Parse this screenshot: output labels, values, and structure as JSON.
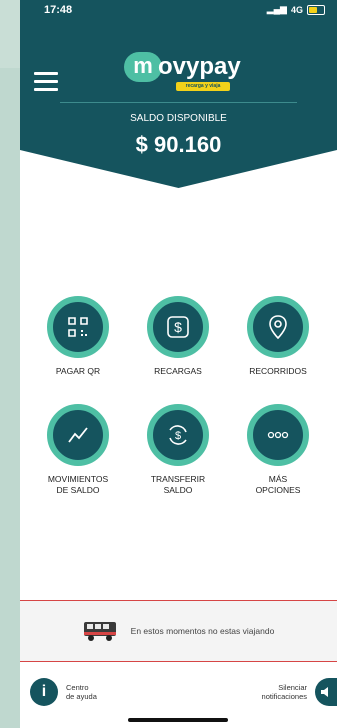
{
  "status_bar": {
    "time": "17:48",
    "signal": "4G"
  },
  "brand": {
    "logo_initial": "m",
    "logo_text": "ovypay",
    "badge": "recarga y viaja"
  },
  "balance": {
    "label": "SALDO DISPONIBLE",
    "amount": "$ 90.160"
  },
  "actions": [
    {
      "label": "PAGAR QR",
      "icon": "qr-icon"
    },
    {
      "label": "RECARGAS",
      "icon": "dollar-icon"
    },
    {
      "label": "RECORRIDOS",
      "icon": "location-pin-icon"
    },
    {
      "label": "MOVIMIENTOS\nDE SALDO",
      "icon": "trend-line-icon"
    },
    {
      "label": "TRANSFERIR\nSALDO",
      "icon": "transfer-icon"
    },
    {
      "label": "MÁS\nOPCIONES",
      "icon": "more-dots-icon"
    }
  ],
  "trip": {
    "message": "En estos momentos no estas viajando"
  },
  "footer": {
    "help_label": "Centro\nde ayuda",
    "silence_label": "Silenciar\nnotificaciones"
  },
  "colors": {
    "primary": "#15545e",
    "accent": "#4ebfa4",
    "badge": "#f2d21a",
    "divider": "#d64545"
  }
}
